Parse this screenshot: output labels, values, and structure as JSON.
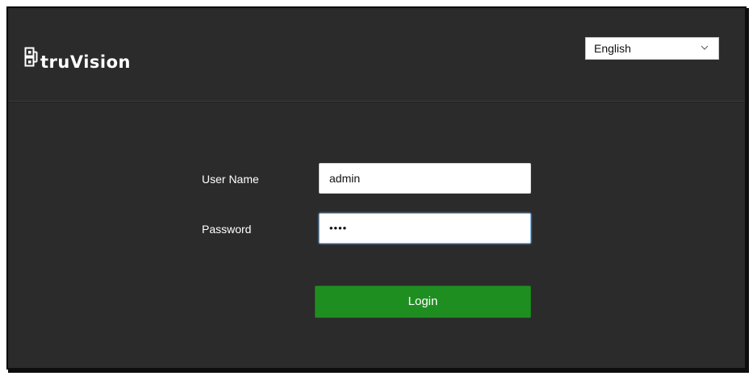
{
  "brand": {
    "name": "truVision"
  },
  "language": {
    "selected": "English"
  },
  "form": {
    "username_label": "User Name",
    "username_value": "admin",
    "password_label": "Password",
    "password_value": "••••",
    "login_label": "Login"
  },
  "colors": {
    "background": "#2b2b2b",
    "login_button": "#1f8e21",
    "input_focus": "#7fb4e0"
  },
  "icons": {
    "logo": "truvision-logo-icon",
    "dropdown": "chevron-down-icon"
  }
}
